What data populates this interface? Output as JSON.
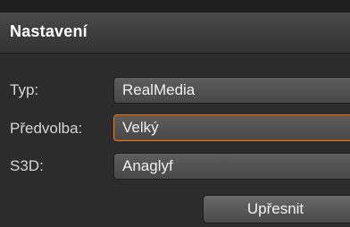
{
  "header": {
    "title": "Nastavení"
  },
  "form": {
    "type_label": "Typ:",
    "type_value": "RealMedia",
    "preset_label": "Předvolba:",
    "preset_value": "Velký",
    "s3d_label": "S3D:",
    "s3d_value": "Anaglyf"
  },
  "actions": {
    "refine_label": "Upřesnit"
  },
  "colors": {
    "background": "#2c2c2c",
    "focus_accent": "#d8792a",
    "text": "#d6d6d6"
  }
}
